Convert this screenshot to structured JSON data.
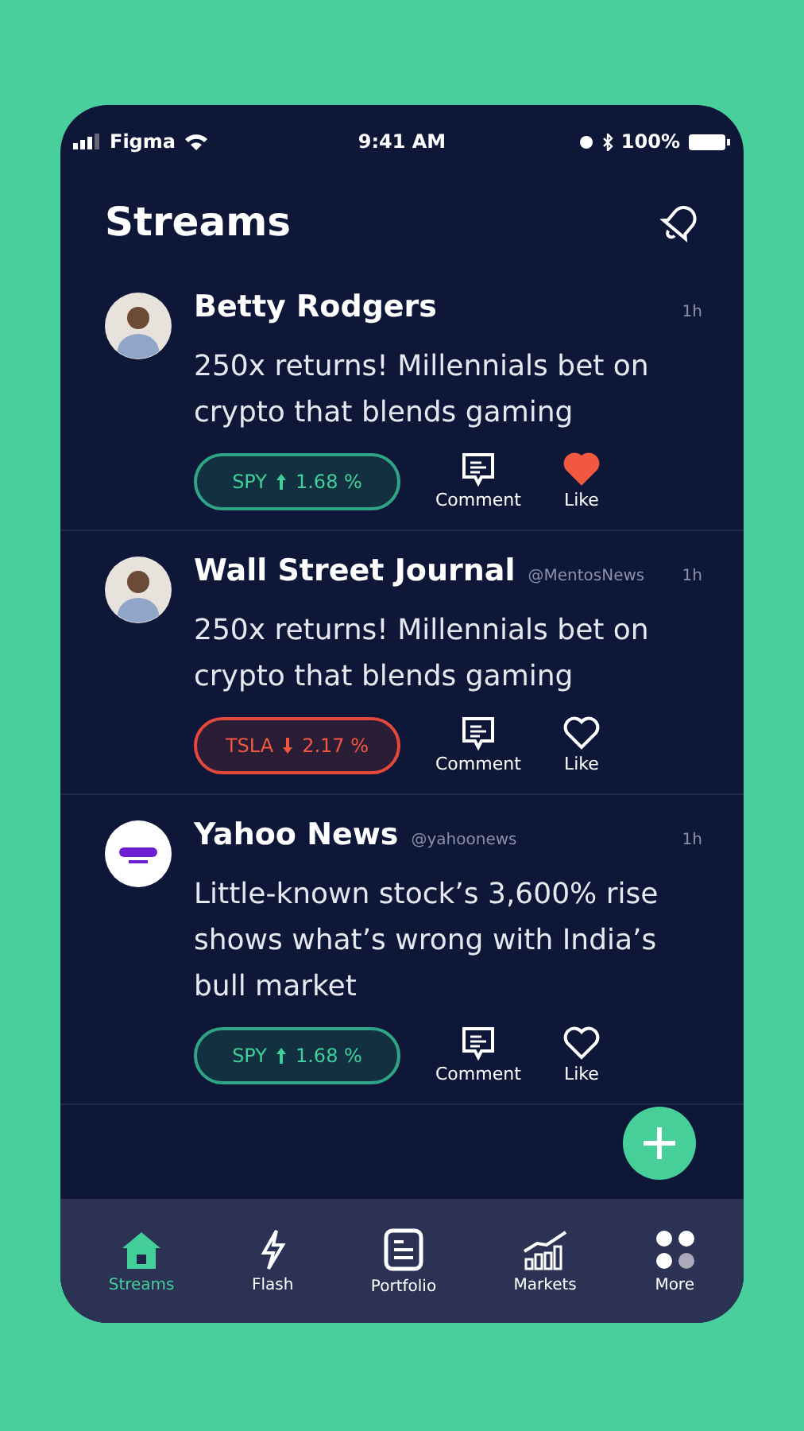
{
  "status_bar": {
    "carrier": "Figma",
    "time": "9:41 AM",
    "battery": "100%"
  },
  "header": {
    "title": "Streams"
  },
  "posts": [
    {
      "kind": "person",
      "author": "Betty Rodgers",
      "time": "1h",
      "text": "250x returns! Millennials bet on crypto that blends gaming",
      "ticker": {
        "kind": "up",
        "symbol": "SPY",
        "change": "1.68 %"
      },
      "comment_label": "Comment",
      "like_label": "Like",
      "liked": true
    },
    {
      "kind": "person",
      "author": "Wall Street Journal",
      "handle": "@MentosNews",
      "time": "1h",
      "text": "250x returns! Millennials bet on crypto that blends gaming",
      "ticker": {
        "kind": "down",
        "symbol": "TSLA",
        "change": "2.17 %"
      },
      "comment_label": "Comment",
      "like_label": "Like",
      "liked": false
    },
    {
      "kind": "logo",
      "author": "Yahoo News",
      "handle": "@yahoonews",
      "time": "1h",
      "text": "Little-known stock’s 3,600% rise shows what’s wrong with India’s bull market",
      "ticker": {
        "kind": "up",
        "symbol": "SPY",
        "change": "1.68 %"
      },
      "comment_label": "Comment",
      "like_label": "Like",
      "liked": false
    }
  ],
  "nav": [
    {
      "kind": "home",
      "label": "Streams",
      "selected": true
    },
    {
      "kind": "flash",
      "label": "Flash",
      "selected": false
    },
    {
      "kind": "portfolio",
      "label": "Portfolio",
      "selected": false
    },
    {
      "kind": "markets",
      "label": "Markets",
      "selected": false
    },
    {
      "kind": "more",
      "label": "More",
      "selected": false
    }
  ]
}
